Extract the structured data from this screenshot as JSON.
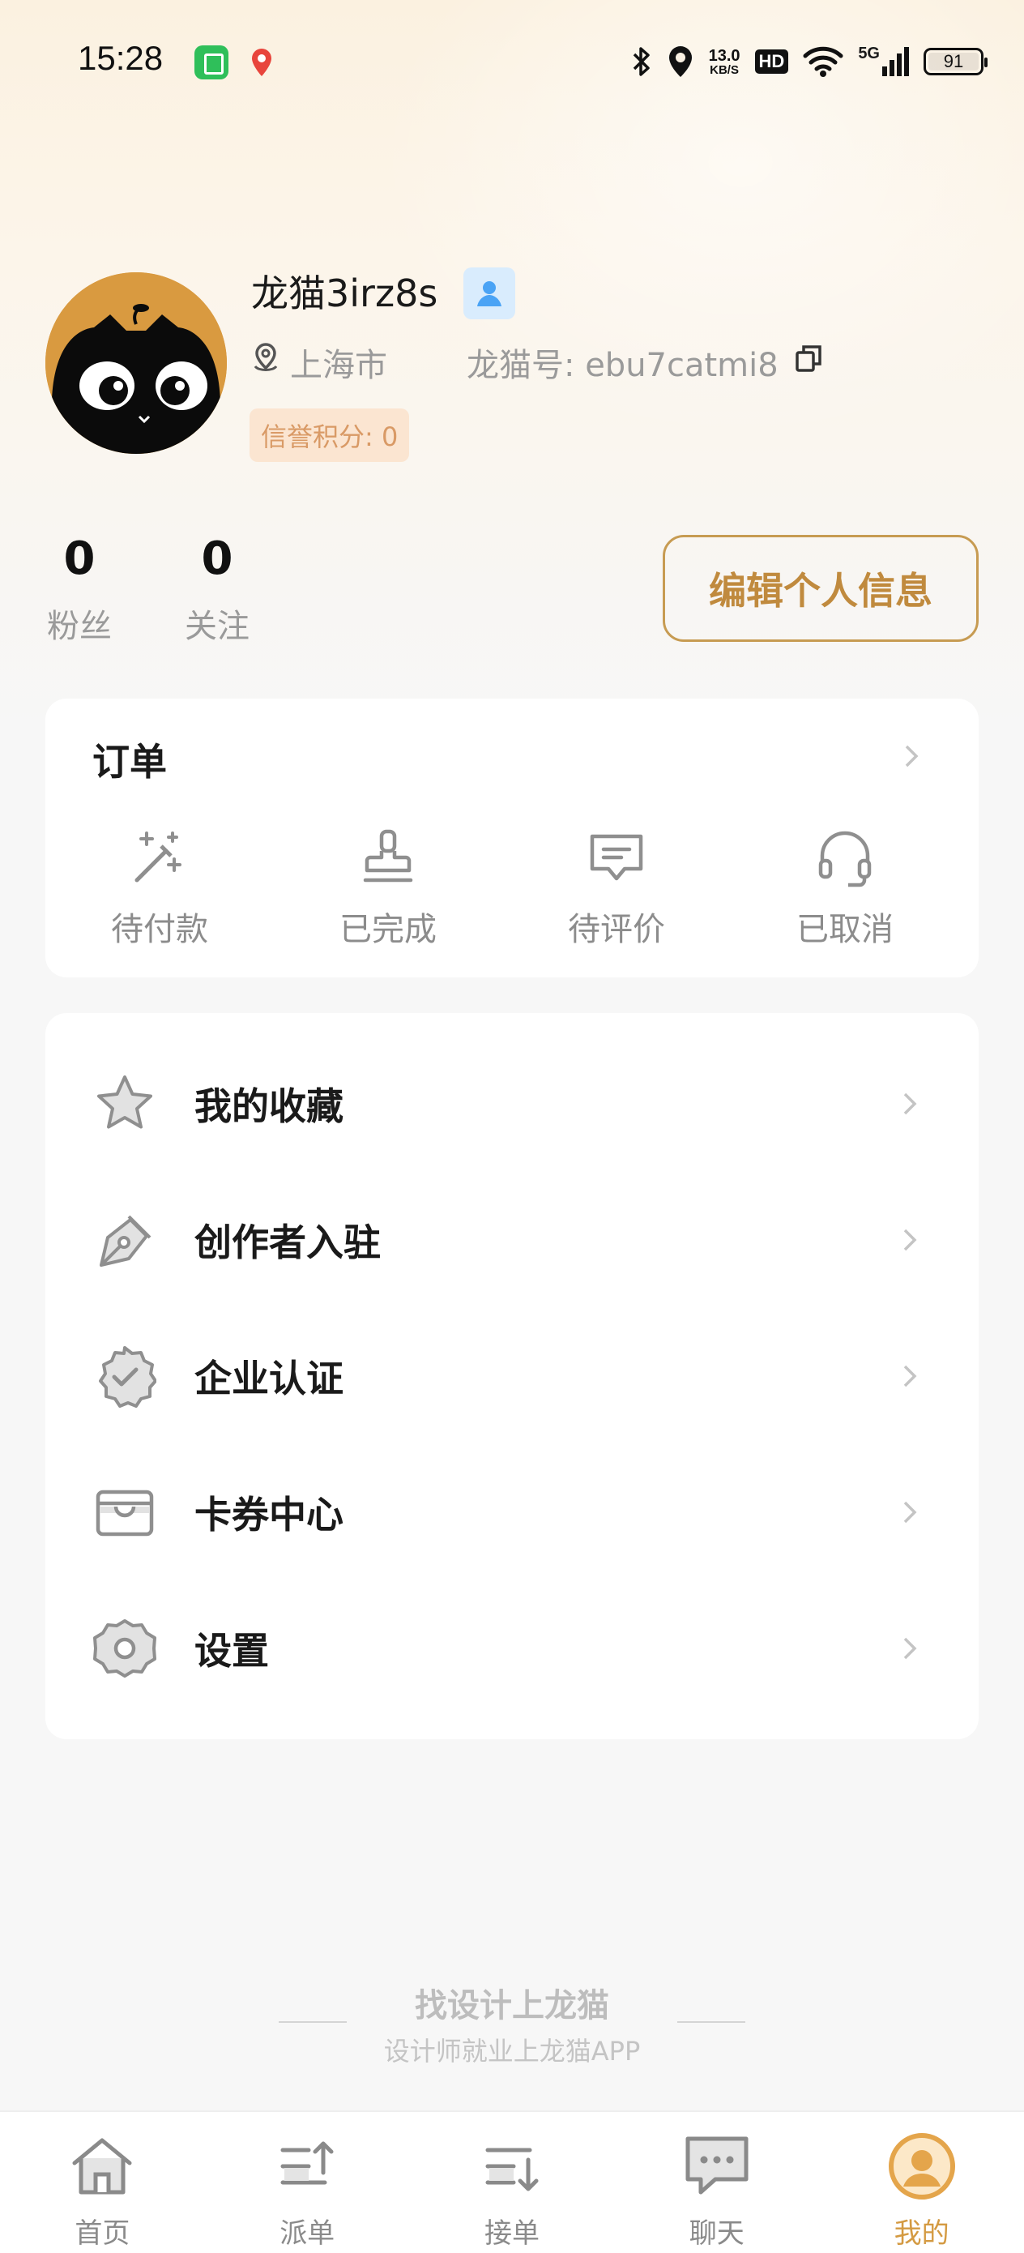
{
  "status_bar": {
    "time": "15:28",
    "speed_value": "13.0",
    "speed_unit": "KB/S",
    "hd": "HD",
    "network": "5G",
    "battery": "91"
  },
  "profile": {
    "username": "龙猫3irz8s",
    "location": "上海市",
    "id_label": "龙猫号: ebu7catmi8",
    "credit": "信誉积分: 0",
    "stats": [
      {
        "value": "0",
        "label": "粉丝"
      },
      {
        "value": "0",
        "label": "关注"
      }
    ],
    "edit_button": "编辑个人信息"
  },
  "orders": {
    "title": "订单",
    "items": [
      {
        "label": "待付款",
        "icon": "magic-wand-icon"
      },
      {
        "label": "已完成",
        "icon": "stamp-icon"
      },
      {
        "label": "待评价",
        "icon": "comment-icon"
      },
      {
        "label": "已取消",
        "icon": "headset-icon"
      }
    ]
  },
  "menu": {
    "items": [
      {
        "label": "我的收藏",
        "icon": "star-icon"
      },
      {
        "label": "创作者入驻",
        "icon": "pen-icon"
      },
      {
        "label": "企业认证",
        "icon": "verified-badge-icon"
      },
      {
        "label": "卡券中心",
        "icon": "card-wallet-icon"
      },
      {
        "label": "设置",
        "icon": "gear-icon"
      }
    ]
  },
  "footer": {
    "slogan": "找设计上龙猫",
    "subtitle": "设计师就业上龙猫APP"
  },
  "tabbar": {
    "active_color": "#d49a42",
    "tabs": [
      {
        "label": "首页",
        "icon": "home-icon"
      },
      {
        "label": "派单",
        "icon": "dispatch-icon"
      },
      {
        "label": "接单",
        "icon": "receive-order-icon"
      },
      {
        "label": "聊天",
        "icon": "chat-icon"
      },
      {
        "label": "我的",
        "icon": "profile-icon"
      }
    ]
  }
}
